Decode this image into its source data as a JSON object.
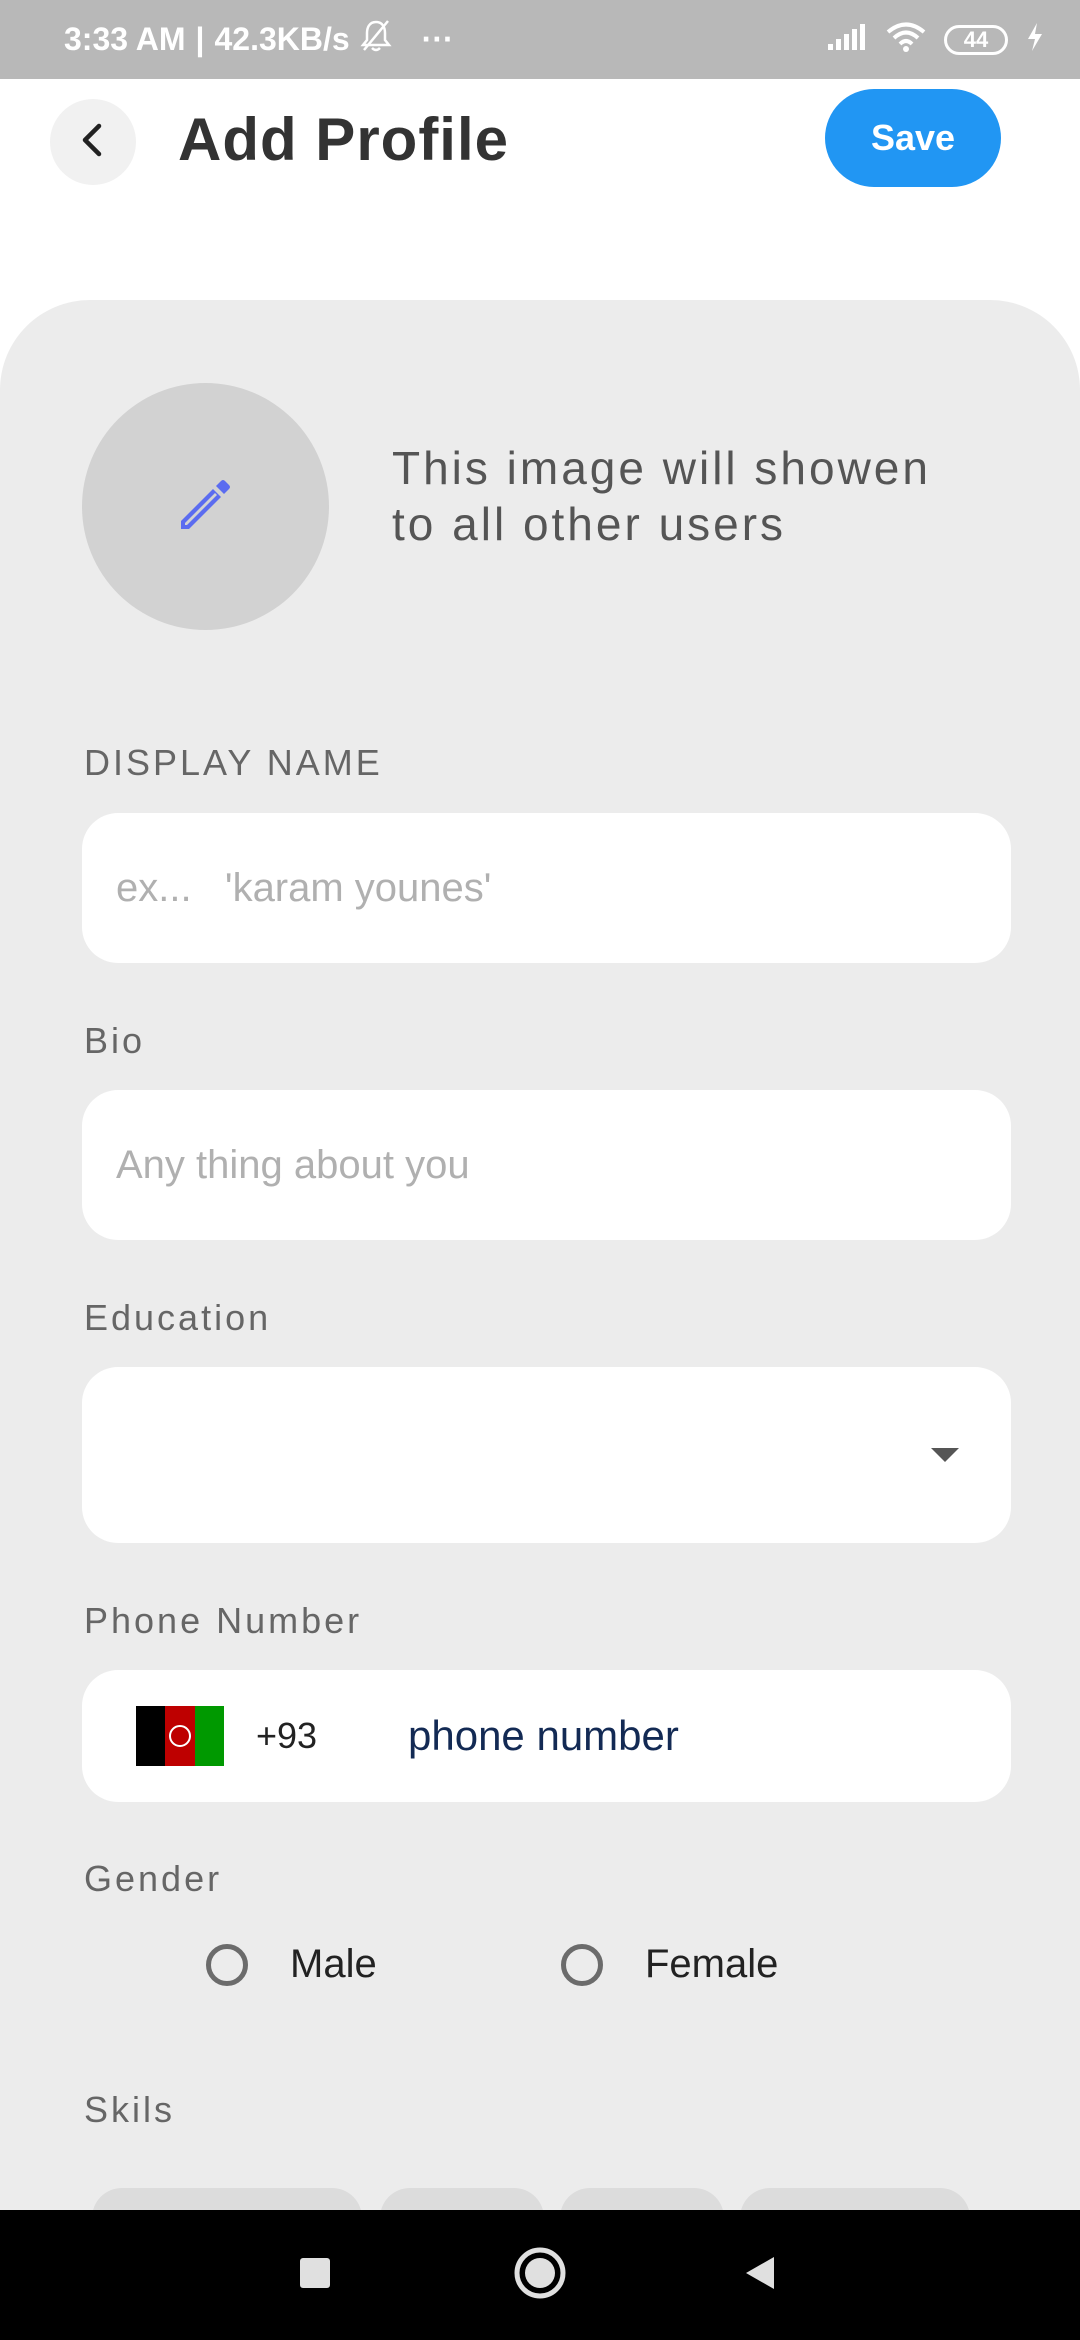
{
  "status_bar": {
    "time": "3:33 AM",
    "separator": "|",
    "speed": "42.3KB/s",
    "more": "···",
    "battery": "44"
  },
  "app_bar": {
    "title": "Add Profile",
    "save_label": "Save"
  },
  "avatar": {
    "caption": "This image will showen\n to all other users"
  },
  "fields": {
    "display_name": {
      "label": "DISPLAY NAME",
      "placeholder": "ex...   'karam younes'"
    },
    "bio": {
      "label": "Bio",
      "placeholder": "Any thing about you"
    },
    "education": {
      "label": "Education",
      "value": ""
    },
    "phone": {
      "label": "Phone Number",
      "dial_code": "+93",
      "placeholder": "phone number"
    },
    "gender": {
      "label": "Gender",
      "options": [
        "Male",
        "Female"
      ]
    },
    "skills": {
      "label": "Skils"
    }
  },
  "colors": {
    "accent": "#2196f3",
    "card_background": "#ececec",
    "edit_icon": "#5b6cf0"
  },
  "icons": {
    "back": "arrow-left-icon",
    "edit": "pencil-icon",
    "dropdown": "caret-down-icon",
    "nav_recents": "square-icon",
    "nav_home": "circle-icon",
    "nav_back": "triangle-icon"
  }
}
